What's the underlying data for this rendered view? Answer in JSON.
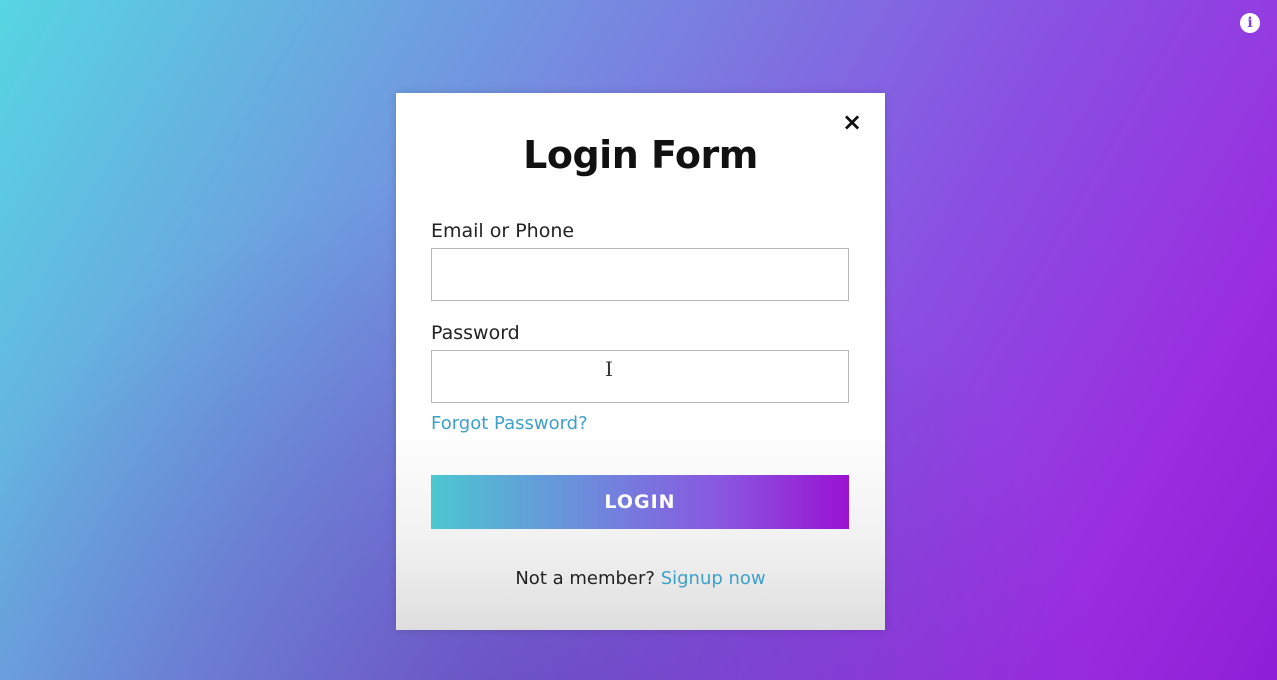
{
  "header": {
    "info_icon": "info-icon",
    "info_glyph": "i"
  },
  "modal": {
    "close_glyph": "×",
    "close_icon": "close-icon",
    "title": "Login Form",
    "email": {
      "label": "Email or Phone",
      "value": "",
      "placeholder": ""
    },
    "password": {
      "label": "Password",
      "value": "",
      "placeholder": ""
    },
    "forgot_link": "Forgot Password?",
    "login_button": "LOGIN",
    "signup_prompt": "Not a member?",
    "signup_link": "Signup now"
  },
  "colors": {
    "link": "#3ea0c7",
    "gradient_start": "#4cc7d0",
    "gradient_end": "#9a12d2",
    "background_start": "#56d6e2",
    "background_end": "#8f1fd6"
  }
}
